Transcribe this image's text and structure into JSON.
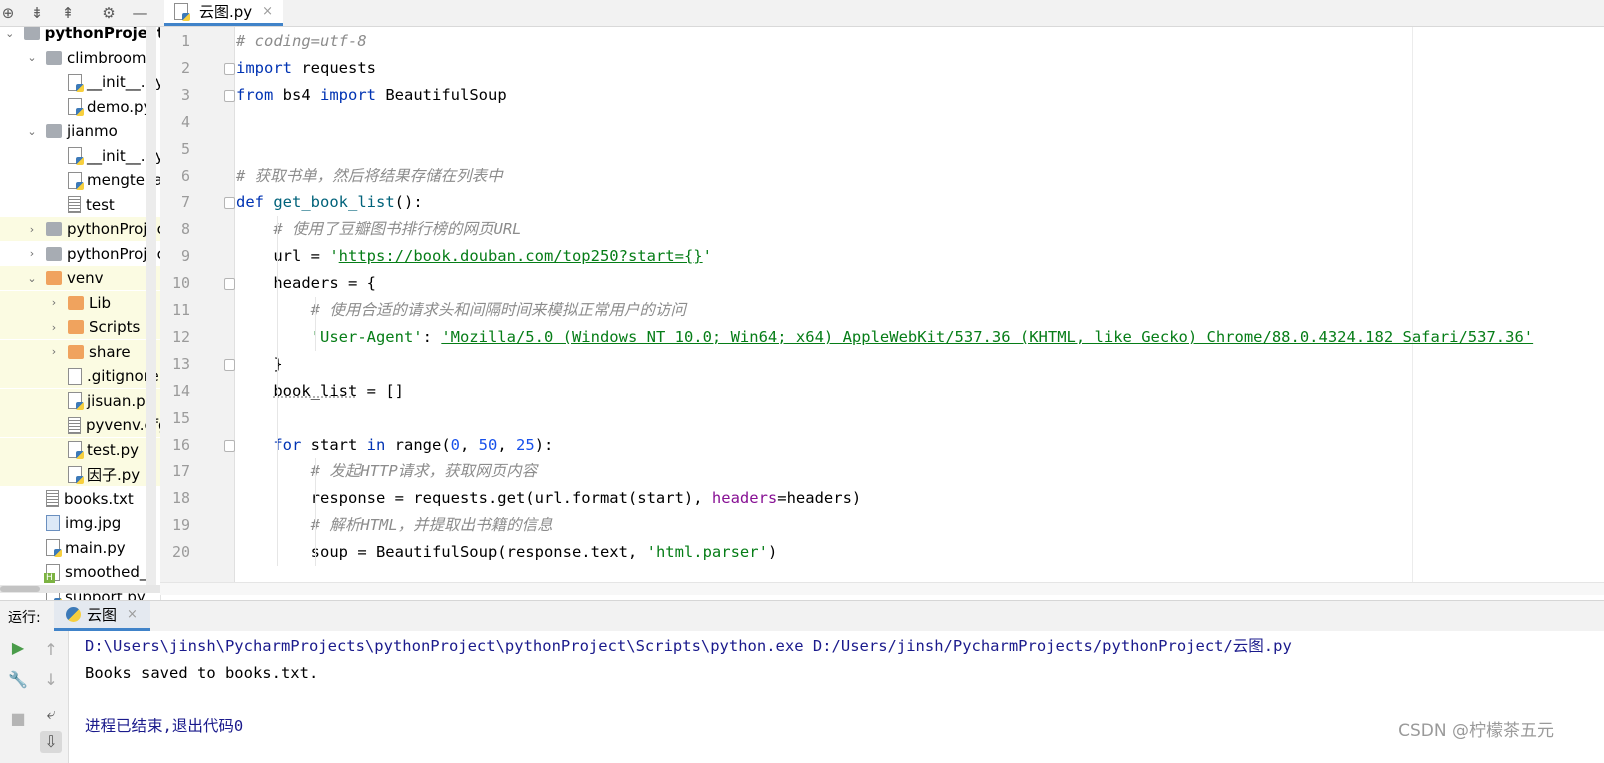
{
  "editor_tab": {
    "label": "云图.py",
    "close": "×"
  },
  "toolbar_icons": [
    "target-icon",
    "expand-all-icon",
    "collapse-all-icon",
    "gear-icon",
    "minimize-icon"
  ],
  "tree": [
    {
      "label": "pythonProject",
      "indent": 0,
      "icon": "folder-grey",
      "arrow": "down",
      "bold": true,
      "hl": false
    },
    {
      "label": "climbroom",
      "indent": 1,
      "icon": "folder-grey",
      "arrow": "down",
      "hl": false
    },
    {
      "label": "__init__.py",
      "indent": 2,
      "icon": "py",
      "arrow": "",
      "hl": false
    },
    {
      "label": "demo.py",
      "indent": 2,
      "icon": "py",
      "arrow": "",
      "hl": false
    },
    {
      "label": "jianmo",
      "indent": 1,
      "icon": "folder-grey",
      "arrow": "down",
      "hl": false
    },
    {
      "label": "__init__.py",
      "indent": 2,
      "icon": "py",
      "arrow": "",
      "hl": false
    },
    {
      "label": "mengteka",
      "indent": 2,
      "icon": "py",
      "arrow": "",
      "hl": false
    },
    {
      "label": "test",
      "indent": 2,
      "icon": "txt",
      "arrow": "",
      "hl": false
    },
    {
      "label": "pythonProject",
      "indent": 1,
      "icon": "folder-grey",
      "arrow": "right",
      "hl": true
    },
    {
      "label": "pythonProject",
      "indent": 1,
      "icon": "folder-grey",
      "arrow": "right",
      "hl": false
    },
    {
      "label": "venv",
      "indent": 1,
      "icon": "folder-orange",
      "arrow": "down",
      "hl": true
    },
    {
      "label": "Lib",
      "indent": 2,
      "icon": "folder-orange",
      "arrow": "right",
      "hl": true
    },
    {
      "label": "Scripts",
      "indent": 2,
      "icon": "folder-orange",
      "arrow": "right",
      "hl": true
    },
    {
      "label": "share",
      "indent": 2,
      "icon": "folder-orange",
      "arrow": "right",
      "hl": true
    },
    {
      "label": ".gitignore",
      "indent": 2,
      "icon": "git",
      "arrow": "",
      "hl": true
    },
    {
      "label": "jisuan.py",
      "indent": 2,
      "icon": "py",
      "arrow": "",
      "hl": true
    },
    {
      "label": "pyvenv.cfg",
      "indent": 2,
      "icon": "txt",
      "arrow": "",
      "hl": true
    },
    {
      "label": "test.py",
      "indent": 2,
      "icon": "py",
      "arrow": "",
      "hl": true
    },
    {
      "label": "因子.py",
      "indent": 2,
      "icon": "py",
      "arrow": "",
      "hl": true
    },
    {
      "label": "books.txt",
      "indent": 1,
      "icon": "txt",
      "arrow": "",
      "hl": false
    },
    {
      "label": "img.jpg",
      "indent": 1,
      "icon": "img",
      "arrow": "",
      "hl": false
    },
    {
      "label": "main.py",
      "indent": 1,
      "icon": "py",
      "arrow": "",
      "hl": false
    },
    {
      "label": "smoothed_",
      "indent": 1,
      "icon": "html",
      "arrow": "",
      "hl": false
    },
    {
      "label": "support.py",
      "indent": 1,
      "icon": "py",
      "arrow": "",
      "hl": false
    }
  ],
  "code_lines": [
    [
      [
        "cm",
        "# coding=utf-8"
      ]
    ],
    [
      [
        "kw",
        "import"
      ],
      [
        "",
        " requests"
      ]
    ],
    [
      [
        "kw",
        "from"
      ],
      [
        "",
        " bs4 "
      ],
      [
        "kw",
        "import"
      ],
      [
        "",
        " BeautifulSoup"
      ]
    ],
    [],
    [],
    [
      [
        "cm",
        "# 获取书单，然后将结果存储在列表中"
      ]
    ],
    [
      [
        "kw",
        "def"
      ],
      [
        "",
        " "
      ],
      [
        "fn",
        "get_book_list"
      ],
      [
        "",
        "():"
      ]
    ],
    [
      [
        "",
        "    "
      ],
      [
        "cm",
        "# 使用了豆瓣图书排行榜的网页URL"
      ]
    ],
    [
      [
        "",
        "    url = "
      ],
      [
        "str",
        "'"
      ],
      [
        "url",
        "https://book.douban.com/top250?start={}"
      ],
      [
        "str",
        "'"
      ]
    ],
    [
      [
        "",
        "    headers = {"
      ]
    ],
    [
      [
        "",
        "        "
      ],
      [
        "cm",
        "# 使用合适的请求头和间隔时间来模拟正常用户的访问"
      ]
    ],
    [
      [
        "",
        "        "
      ],
      [
        "str",
        "'User-Agent'"
      ],
      [
        "",
        ": "
      ],
      [
        "url",
        "'Mozilla/5.0 (Windows NT 10.0; Win64; x64) AppleWebKit/537.36 (KHTML, like Gecko) Chrome/88.0.4324.182 Safari/537.36'"
      ]
    ],
    [
      [
        "",
        "    }"
      ]
    ],
    [
      [
        "",
        "    "
      ],
      [
        "squig",
        "book_list"
      ],
      [
        "",
        " = []"
      ]
    ],
    [],
    [
      [
        "",
        "    "
      ],
      [
        "kw",
        "for"
      ],
      [
        "",
        " start "
      ],
      [
        "kw",
        "in"
      ],
      [
        "",
        " range("
      ],
      [
        "num",
        "0"
      ],
      [
        "",
        ", "
      ],
      [
        "num",
        "50"
      ],
      [
        "",
        ", "
      ],
      [
        "num",
        "25"
      ],
      [
        "",
        "):"
      ]
    ],
    [
      [
        "",
        "        "
      ],
      [
        "cm",
        "# 发起HTTP请求，获取网页内容"
      ]
    ],
    [
      [
        "",
        "        response = requests.get(url.format(start), "
      ],
      [
        "param",
        "headers"
      ],
      [
        "",
        "=headers)"
      ]
    ],
    [
      [
        "",
        "        "
      ],
      [
        "cm",
        "# 解析HTML，并提取出书籍的信息"
      ]
    ],
    [
      [
        "",
        "        soup = BeautifulSoup(response.text, "
      ],
      [
        "str",
        "'html.parser'"
      ],
      [
        "",
        ")"
      ]
    ]
  ],
  "fold_lines": [
    2,
    3,
    7,
    10,
    13,
    16
  ],
  "run_panel": {
    "label": "运行:",
    "tab_label": "云图",
    "tab_close": "×",
    "console": [
      {
        "text": "D:\\Users\\jinsh\\PycharmProjects\\pythonProject\\pythonProject\\Scripts\\python.exe D:/Users/jinsh/PycharmProjects/pythonProject/云图.py",
        "color": "#1a1a8c"
      },
      {
        "text": "Books saved to books.txt.",
        "color": "#000000"
      },
      {
        "text": "",
        "color": "#000000"
      },
      {
        "text": "进程已结束,退出代码0",
        "color": "#1a1a8c"
      }
    ]
  },
  "watermark": "CSDN @柠檬茶五元",
  "colors": {
    "accent": "#4083c9",
    "keyword": "#0033b3",
    "string": "#067d17",
    "comment": "#8c8c8c",
    "number": "#1750eb",
    "highlight_row": "#fbfbe2"
  }
}
